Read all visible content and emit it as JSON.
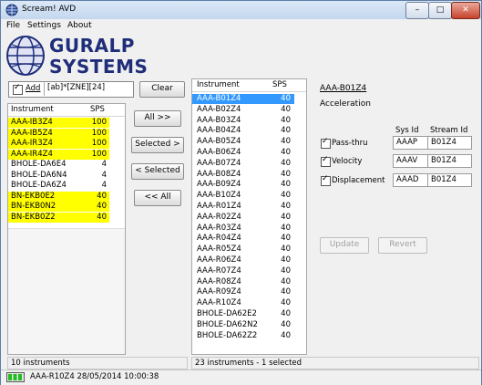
{
  "window": {
    "title": "Scream! AVD",
    "min_label": "–",
    "max_label": "□",
    "close_label": "✕"
  },
  "menu": {
    "file": "File",
    "settings": "Settings",
    "about": "About"
  },
  "logo": {
    "line1": "GURALP",
    "line2": "SYSTEMS"
  },
  "filter": {
    "add_label": "Add",
    "add_checked": true,
    "pattern": "[ab]*[ZNE][24]",
    "clear_label": "Clear"
  },
  "left_table": {
    "col_instrument": "Instrument",
    "col_sps": "SPS",
    "rows": [
      {
        "name": "AAA-IB3Z4",
        "sps": "100",
        "highlight": true
      },
      {
        "name": "AAA-IB5Z4",
        "sps": "100",
        "highlight": true
      },
      {
        "name": "AAA-IR3Z4",
        "sps": "100",
        "highlight": true
      },
      {
        "name": "AAA-IR4Z4",
        "sps": "100",
        "highlight": true
      },
      {
        "name": "BHOLE-DA6E4",
        "sps": "4",
        "highlight": false
      },
      {
        "name": "BHOLE-DA6N4",
        "sps": "4",
        "highlight": false
      },
      {
        "name": "BHOLE-DA6Z4",
        "sps": "4",
        "highlight": false
      },
      {
        "name": "BN-EKB0E2",
        "sps": "40",
        "highlight": true
      },
      {
        "name": "BN-EKB0N2",
        "sps": "40",
        "highlight": true
      },
      {
        "name": "BN-EKB0Z2",
        "sps": "40",
        "highlight": true
      }
    ],
    "status": "10 instruments"
  },
  "mid_buttons": {
    "all_right": "All >>",
    "selected_right": "Selected >",
    "selected_left": "< Selected",
    "all_left": "<< All"
  },
  "right_table": {
    "col_instrument": "Instrument",
    "col_sps": "SPS",
    "rows": [
      {
        "name": "AAA-B01Z4",
        "sps": "40",
        "selected": true
      },
      {
        "name": "AAA-B02Z4",
        "sps": "40",
        "selected": false
      },
      {
        "name": "AAA-B03Z4",
        "sps": "40",
        "selected": false
      },
      {
        "name": "AAA-B04Z4",
        "sps": "40",
        "selected": false
      },
      {
        "name": "AAA-B05Z4",
        "sps": "40",
        "selected": false
      },
      {
        "name": "AAA-B06Z4",
        "sps": "40",
        "selected": false
      },
      {
        "name": "AAA-B07Z4",
        "sps": "40",
        "selected": false
      },
      {
        "name": "AAA-B08Z4",
        "sps": "40",
        "selected": false
      },
      {
        "name": "AAA-B09Z4",
        "sps": "40",
        "selected": false
      },
      {
        "name": "AAA-B10Z4",
        "sps": "40",
        "selected": false
      },
      {
        "name": "AAA-R01Z4",
        "sps": "40",
        "selected": false
      },
      {
        "name": "AAA-R02Z4",
        "sps": "40",
        "selected": false
      },
      {
        "name": "AAA-R03Z4",
        "sps": "40",
        "selected": false
      },
      {
        "name": "AAA-R04Z4",
        "sps": "40",
        "selected": false
      },
      {
        "name": "AAA-R05Z4",
        "sps": "40",
        "selected": false
      },
      {
        "name": "AAA-R06Z4",
        "sps": "40",
        "selected": false
      },
      {
        "name": "AAA-R07Z4",
        "sps": "40",
        "selected": false
      },
      {
        "name": "AAA-R08Z4",
        "sps": "40",
        "selected": false
      },
      {
        "name": "AAA-R09Z4",
        "sps": "40",
        "selected": false
      },
      {
        "name": "AAA-R10Z4",
        "sps": "40",
        "selected": false
      },
      {
        "name": "BHOLE-DA62E2",
        "sps": "40",
        "selected": false
      },
      {
        "name": "BHOLE-DA62N2",
        "sps": "40",
        "selected": false
      },
      {
        "name": "BHOLE-DA62Z2",
        "sps": "40",
        "selected": false
      }
    ],
    "status": "23 instruments - 1 selected"
  },
  "detail": {
    "instrument": "AAA-B01Z4",
    "type": "Acceleration",
    "col_sysid": "Sys Id",
    "col_streamid": "Stream Id",
    "rows": [
      {
        "label": "Pass-thru",
        "checked": true,
        "sysid": "AAAP",
        "streamid": "B01Z4"
      },
      {
        "label": "Velocity",
        "checked": true,
        "sysid": "AAAV",
        "streamid": "B01Z4"
      },
      {
        "label": "Displacement",
        "checked": true,
        "sysid": "AAAD",
        "streamid": "B01Z4"
      }
    ],
    "update_label": "Update",
    "revert_label": "Revert"
  },
  "bottom_status": {
    "text": "AAA-R10Z4 28/05/2014 10:00:38"
  },
  "colors": {
    "highlight": "#ffff00",
    "selection": "#3399ff",
    "logo_blue": "#1f2d7a",
    "status_green": "#22bb22"
  }
}
